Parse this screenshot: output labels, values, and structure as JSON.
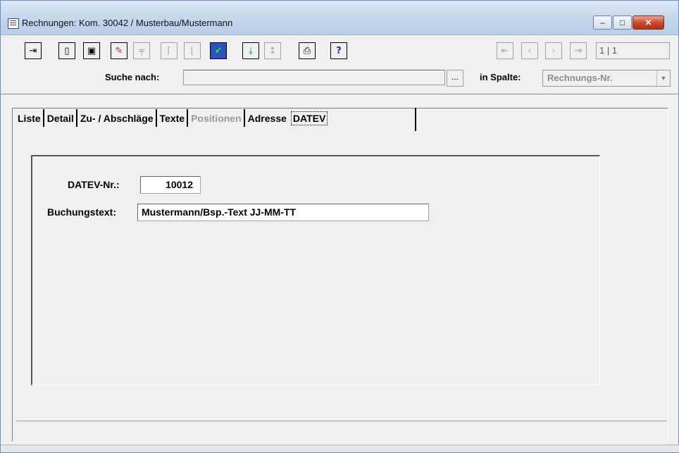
{
  "window": {
    "title": "Rechnungen: Kom. 30042 / Musterbau/Mustermann",
    "controls": {
      "minimize": "–",
      "maximize": "□",
      "close": "✕"
    }
  },
  "toolbar": {
    "buttons": [
      {
        "name": "exit-icon",
        "glyph": "⇥",
        "enabled": true
      },
      {
        "name": "new-document-icon",
        "glyph": "▯",
        "enabled": true
      },
      {
        "name": "save-icon",
        "glyph": "▣",
        "enabled": true
      },
      {
        "name": "edit-icon",
        "glyph": "✎",
        "enabled": true
      },
      {
        "name": "insert-row-icon",
        "glyph": "╤",
        "enabled": false
      },
      {
        "name": "copy-record-icon",
        "glyph": "⌈",
        "enabled": false
      },
      {
        "name": "delete-record-icon",
        "glyph": "⌊",
        "enabled": false
      },
      {
        "name": "check-icon",
        "glyph": "✔",
        "enabled": true
      },
      {
        "name": "import-icon",
        "glyph": "⤓",
        "enabled": true
      },
      {
        "name": "sort-icon",
        "glyph": "↕",
        "enabled": false
      },
      {
        "name": "print-icon",
        "glyph": "⎙",
        "enabled": true
      },
      {
        "name": "help-icon",
        "glyph": "?",
        "enabled": true
      }
    ],
    "nav": [
      {
        "name": "first-record-icon",
        "glyph": "⇤"
      },
      {
        "name": "prev-record-icon",
        "glyph": "‹"
      },
      {
        "name": "next-record-icon",
        "glyph": "›"
      },
      {
        "name": "last-record-icon",
        "glyph": "⇥"
      }
    ],
    "record_counter": "1 | 1"
  },
  "search": {
    "label": "Suche nach:",
    "value": "",
    "button_label": "...",
    "column_label": "in Spalte:",
    "column_value": "Rechnungs-Nr."
  },
  "tabs": [
    {
      "label": "Liste",
      "enabled": true
    },
    {
      "label": "Detail",
      "enabled": true
    },
    {
      "label": "Zu- / Abschläge",
      "enabled": true
    },
    {
      "label": "Texte",
      "enabled": true
    },
    {
      "label": "Positionen",
      "enabled": false
    },
    {
      "label": "Adresse",
      "enabled": true
    },
    {
      "label": "DATEV",
      "enabled": true,
      "active": true
    }
  ],
  "datev": {
    "nr_label": "DATEV-Nr.:",
    "nr_value": "10012",
    "text_label": "Buchungstext:",
    "text_value": "Mustermann/Bsp.-Text JJ-MM-TT"
  }
}
